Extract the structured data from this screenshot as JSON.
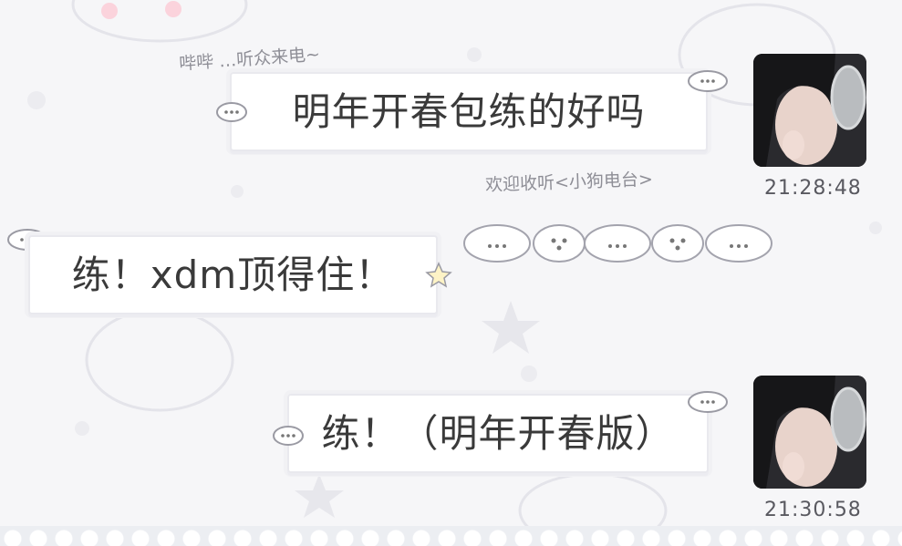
{
  "messages": [
    {
      "side": "right",
      "text": "明年开春包练的好吗",
      "time": "21:28:48"
    },
    {
      "side": "left",
      "text": "练！xdm顶得住！"
    },
    {
      "side": "right",
      "text": "练！（明年开春版）",
      "time": "21:30:58"
    }
  ],
  "decorations": {
    "top_label": "哔哔 …听众来电~",
    "bottom_label": "欢迎收听<小狗电台>"
  },
  "colors": {
    "background": "#f6f6f8",
    "bubble": "#ffffff",
    "text": "#3a3a3a",
    "timestamp": "#595960"
  }
}
